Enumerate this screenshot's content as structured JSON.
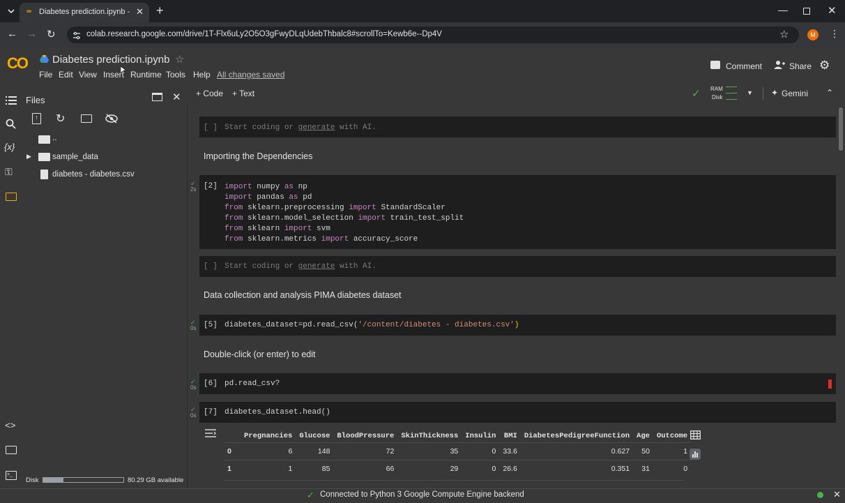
{
  "browser": {
    "tab_title": "Diabetes prediction.ipynb - Co",
    "url": "colab.research.google.com/drive/1T-Flx6uLy2O5O3gFwyDLqUdebThbalc8#scrollTo=Kewb6e--Dp4V",
    "profile_initial": "M"
  },
  "header": {
    "logo": "CO",
    "notebook_title": "Diabetes prediction.ipynb",
    "menus": [
      "File",
      "Edit",
      "View",
      "Insert",
      "Runtime",
      "Tools",
      "Help"
    ],
    "save_status": "All changes saved",
    "comment_label": "Comment",
    "share_label": "Share"
  },
  "toolbar": {
    "code_label": "+ Code",
    "text_label": "+ Text",
    "ram_label": "RAM",
    "disk_label": "Disk",
    "gemini_label": "Gemini"
  },
  "files": {
    "title": "Files",
    "parent": "..",
    "items": [
      "sample_data",
      "diabetes - diabetes.csv"
    ],
    "disk_label": "Disk",
    "disk_available": "80.29 GB available"
  },
  "cells": {
    "empty_prompt": [
      "Start coding or ",
      "generate",
      " with AI."
    ],
    "empty_bracket": "[ ]",
    "text1": "Importing the Dependencies",
    "cell2_num": "[2]",
    "cell2_time": "2s",
    "cell2_lines": [
      [
        "import",
        " numpy ",
        "as",
        " np"
      ],
      [
        "import",
        " pandas ",
        "as",
        " pd"
      ],
      [
        "from",
        " sklearn.preprocessing ",
        "import",
        " StandardScaler"
      ],
      [
        "from",
        " sklearn.model_selection ",
        "import",
        " train_test_split"
      ],
      [
        "from",
        " sklearn ",
        "import",
        " svm"
      ],
      [
        "from",
        " sklearn.metrics ",
        "import",
        " accuracy_score"
      ]
    ],
    "text2": "Data collection and analysis PIMA diabetes dataset",
    "cell5_num": "[5]",
    "cell5_time": "0s",
    "cell5_code_a": "diabetes_dataset=pd.read_csv(",
    "cell5_code_str": "'/content/diabetes - diabetes.csv'",
    "cell5_code_b": ")",
    "text3": "Double-click (or enter) to edit",
    "cell6_num": "[6]",
    "cell6_time": "0s",
    "cell6_code": "pd.read_csv?",
    "cell7_num": "[7]",
    "cell7_time": "0s",
    "cell7_code": "diabetes_dataset.head()"
  },
  "dataframe": {
    "columns": [
      "",
      "Pregnancies",
      "Glucose",
      "BloodPressure",
      "SkinThickness",
      "Insulin",
      "BMI",
      "DiabetesPedigreeFunction",
      "Age",
      "Outcome"
    ],
    "rows": [
      [
        "0",
        "6",
        "148",
        "72",
        "35",
        "0",
        "33.6",
        "0.627",
        "50",
        "1"
      ],
      [
        "1",
        "1",
        "85",
        "66",
        "29",
        "0",
        "26.6",
        "0.351",
        "31",
        "0"
      ]
    ]
  },
  "status": {
    "text": "Connected to Python 3 Google Compute Engine backend"
  }
}
